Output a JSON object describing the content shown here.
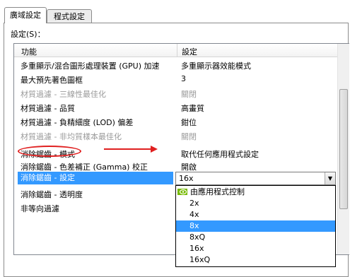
{
  "tabs": [
    {
      "label": "廣域設定",
      "active": true
    },
    {
      "label": "程式設定",
      "active": false
    }
  ],
  "settings_label": "設定(S)：",
  "columns": {
    "feature": "功能",
    "setting": "設定"
  },
  "rows": [
    {
      "feature": "多重顯示/混合圖形處理裝置 (GPU) 加速",
      "value": "多重顯示器效能模式"
    },
    {
      "feature": "最大預先著色圖框",
      "value": "3"
    },
    {
      "feature": "材質過濾 - 三線性最佳化",
      "value": "關閉"
    },
    {
      "feature": "材質過濾 - 品質",
      "value": "高畫質"
    },
    {
      "feature": "材質過濾 - 負精細度 (LOD) 偏差",
      "value": "鉗位"
    },
    {
      "feature": "材質過濾 - 非均質樣本最佳化",
      "value": "關閉"
    },
    {
      "feature": "消除鋸齒 - 模式",
      "value": "取代任何應用程式設定"
    },
    {
      "feature": "消除鋸齒 - 色差補正 (Gamma) 校正",
      "value": "開啟"
    },
    {
      "feature": "消除鋸齒 - 設定",
      "value": "16x"
    },
    {
      "feature": "消除鋸齒 - 透明度",
      "value": ""
    },
    {
      "feature": "非等向過濾",
      "value": ""
    }
  ],
  "dropdown": {
    "current": "16x",
    "options": [
      "由應用程式控制",
      "2x",
      "4x",
      "8x",
      "8xQ",
      "16x",
      "16xQ"
    ],
    "highlighted": "8x"
  },
  "colors": {
    "selection": "#3399ff",
    "annotation": "#e02020",
    "nvidia_green": "#76b900"
  }
}
